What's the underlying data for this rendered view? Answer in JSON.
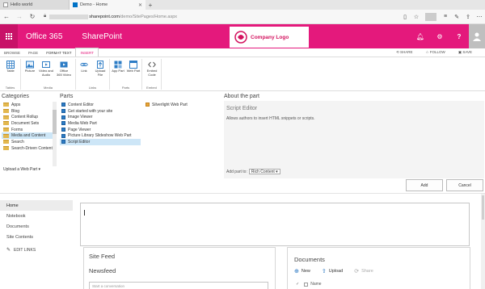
{
  "browser": {
    "tabs": [
      {
        "title": "Hello world",
        "active": false
      },
      {
        "title": "Demo - Home",
        "active": true
      }
    ],
    "new_tab": "+",
    "address": {
      "host": "sharepoint.com",
      "path": "/demo/SitePages/Home.aspx"
    }
  },
  "suite": {
    "brand": "Office 365",
    "app": "SharePoint",
    "logo_text": "Company Logo",
    "colors": {
      "accent": "#e4197c",
      "accent_dark": "#c81268"
    }
  },
  "ribbon_tabs": [
    "BROWSE",
    "PAGE",
    "FORMAT TEXT",
    "INSERT"
  ],
  "ribbon_actions": [
    "SHARE",
    "FOLLOW",
    "SAVE"
  ],
  "ribbon_groups": [
    {
      "label": "Tables",
      "buttons": [
        "Table"
      ]
    },
    {
      "label": "Media",
      "buttons": [
        "Picture",
        "Video and Audio",
        "Office 365 Video"
      ]
    },
    {
      "label": "Links",
      "buttons": [
        "Link",
        "Upload File"
      ]
    },
    {
      "label": "Parts",
      "buttons": [
        "App Part",
        "Web Part"
      ]
    },
    {
      "label": "Embed",
      "buttons": [
        "Embed Code"
      ]
    }
  ],
  "picker": {
    "categories_heading": "Categories",
    "parts_heading": "Parts",
    "about_heading": "About the part",
    "categories": [
      "Apps",
      "Blog",
      "Content Rollup",
      "Document Sets",
      "Forms",
      "Media and Content",
      "Search",
      "Search-Driven Content"
    ],
    "selected_category": "Media and Content",
    "parts_col1": [
      "Content Editor",
      "Get started with your site",
      "Image Viewer",
      "Media Web Part",
      "Page Viewer",
      "Picture Library Slideshow Web Part",
      "Script Editor"
    ],
    "parts_col2": [
      "Silverlight Web Part"
    ],
    "selected_part": "Script Editor",
    "upload_label": "Upload a Web Part",
    "about_title": "Script Editor",
    "about_desc": "Allows authors to insert HTML snippets or scripts.",
    "add_part_to_label": "Add part to:",
    "add_part_to_value": "Rich Content"
  },
  "actions": {
    "add": "Add",
    "cancel": "Cancel"
  },
  "leftnav": {
    "items": [
      "Home",
      "Notebook",
      "Documents",
      "Site Contents"
    ],
    "edit_links": "EDIT LINKS"
  },
  "site_feed": {
    "title": "Site Feed",
    "newsfeed": "Newsfeed",
    "placeholder": "Start a conversation"
  },
  "documents": {
    "title": "Documents",
    "new": "New",
    "upload": "Upload",
    "share": "Share",
    "column_name": "Name"
  }
}
